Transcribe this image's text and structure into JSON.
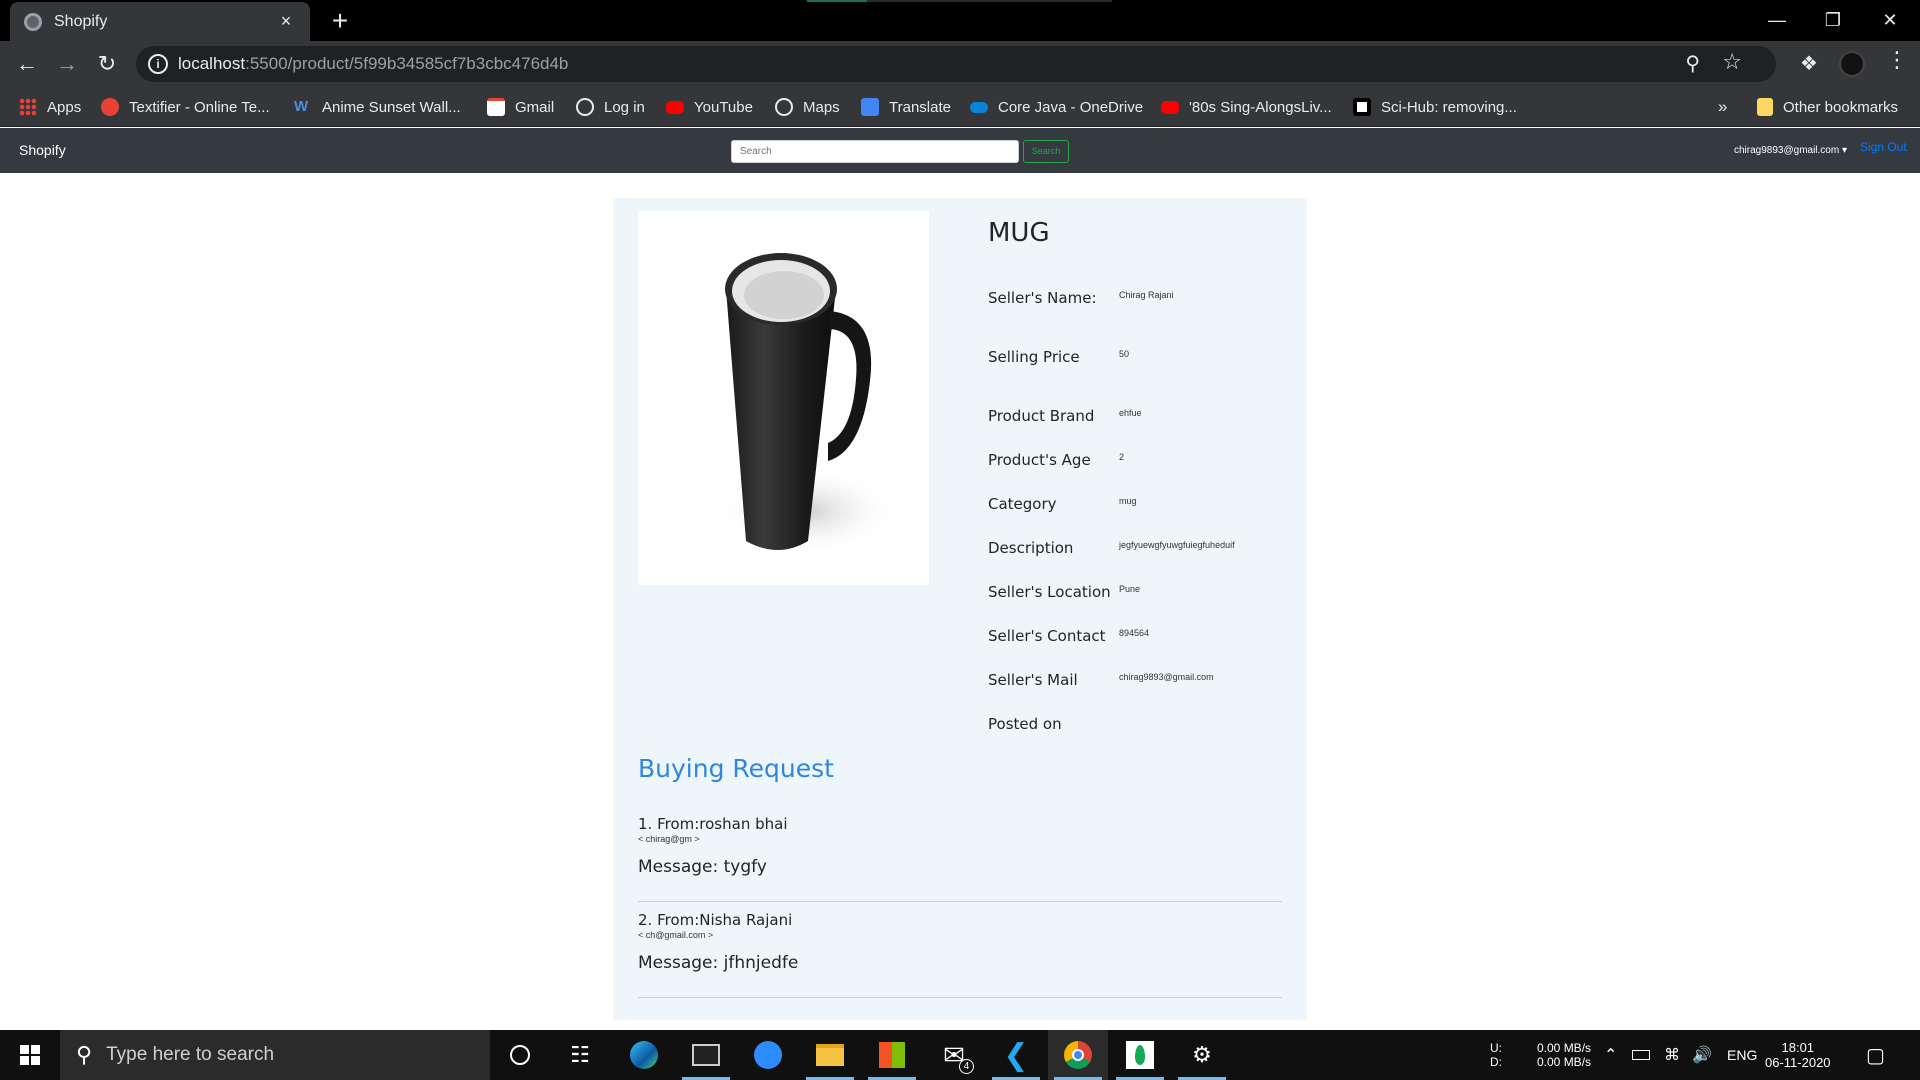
{
  "browser": {
    "tab_title": "Shopify",
    "tab_close": "×",
    "new_tab": "+",
    "url_host": "localhost",
    "url_rest": ":5500/product/5f99b34585cf7b3cbc476d4b",
    "window_controls": [
      "—",
      "❐",
      "✕"
    ],
    "bookmarks": [
      {
        "label": "Apps",
        "icon": "apps-grid-icon",
        "color": "#e94235"
      },
      {
        "label": "Textifier - Online Te...",
        "icon": "textifier-icon",
        "color": "#e94235"
      },
      {
        "label": "Anime Sunset Wall...",
        "icon": "wallpaper-w-icon",
        "color": "#4a90e2"
      },
      {
        "label": "Gmail",
        "icon": "gmail-icon",
        "color": "#ea4335"
      },
      {
        "label": "Log in",
        "icon": "globe-icon",
        "color": "#e8eaed"
      },
      {
        "label": "YouTube",
        "icon": "youtube-icon",
        "color": "#ff0000"
      },
      {
        "label": "Maps",
        "icon": "globe-icon",
        "color": "#e8eaed"
      },
      {
        "label": "Translate",
        "icon": "translate-icon",
        "color": "#4285f4"
      },
      {
        "label": "Core Java - OneDrive",
        "icon": "onedrive-icon",
        "color": "#0a84d8"
      },
      {
        "label": "'80s Sing-AlongsLiv...",
        "icon": "youtube-icon",
        "color": "#ff0000"
      },
      {
        "label": "Sci-Hub: removing...",
        "icon": "scihub-icon",
        "color": "#ffffff"
      }
    ],
    "bookmarks_overflow": "»",
    "other_bookmarks": "Other bookmarks"
  },
  "app": {
    "brand": "Shopify",
    "search_placeholder": "Search",
    "search_button": "Search",
    "user_email": "chirag9893@gmail.com ▾",
    "sign_out": "Sign Out"
  },
  "product": {
    "title": "MUG",
    "image_alt": "black-mug",
    "details": [
      {
        "label": "Seller's Name:",
        "value": "Chirag Rajani"
      },
      {
        "label": "Selling Price",
        "value": "50"
      },
      {
        "label": "Product Brand",
        "value": "ehfue"
      },
      {
        "label": "Product's Age",
        "value": "2"
      },
      {
        "label": "Category",
        "value": "mug"
      },
      {
        "label": "Description",
        "value": "jegfyuewgfyuwgfuiegfuheduif"
      },
      {
        "label": "Seller's Location",
        "value": "Pune"
      },
      {
        "label": "Seller's Contact",
        "value": "894564"
      },
      {
        "label": "Seller's Mail",
        "value": "chirag9893@gmail.com"
      },
      {
        "label": "Posted on",
        "value": ""
      }
    ]
  },
  "buying": {
    "title": "Buying Request",
    "requests": [
      {
        "from": "1.  From:roshan bhai",
        "mail": "< chirag@gm >",
        "message": "Message: tygfy"
      },
      {
        "from": "2.  From:Nisha Rajani",
        "mail": "< ch@gmail.com >",
        "message": "Message: jfhnjedfe"
      }
    ]
  },
  "taskbar": {
    "search_placeholder": "Type here to search",
    "mail_badge": "4",
    "net_up_label": "U:",
    "net_down_label": "D:",
    "net_up": "0.00 MB/s",
    "net_down": "0.00 MB/s",
    "lang": "ENG",
    "time": "18:01",
    "date": "06-11-2020"
  }
}
